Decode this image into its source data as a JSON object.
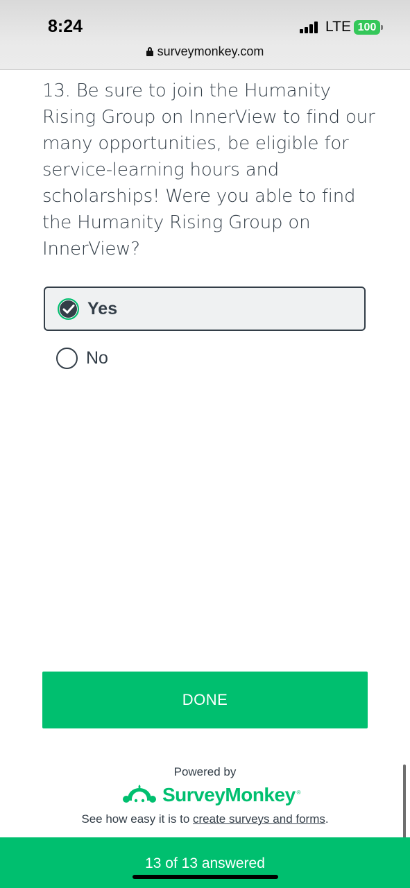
{
  "status_bar": {
    "time": "8:24",
    "network": "LTE",
    "battery": "100"
  },
  "browser": {
    "url": "surveymonkey.com"
  },
  "question": {
    "text": "13. Be sure to join the Humanity Rising Group on InnerView to find our many opportunities, be eligible for service-learning hours and scholarships!   Were you able to find the Humanity Rising Group on InnerView?"
  },
  "options": {
    "yes": {
      "label": "Yes",
      "selected": true
    },
    "no": {
      "label": "No",
      "selected": false
    }
  },
  "actions": {
    "done_label": "DONE"
  },
  "footer": {
    "powered_by": "Powered by",
    "brand": "SurveyMonkey",
    "brand_mark": "®",
    "tagline_prefix": "See how easy it is to ",
    "tagline_link": "create surveys and forms",
    "tagline_suffix": "."
  },
  "progress": {
    "text": "13 of 13 answered"
  },
  "colors": {
    "accent": "#00bf6f",
    "text": "#333e48"
  }
}
